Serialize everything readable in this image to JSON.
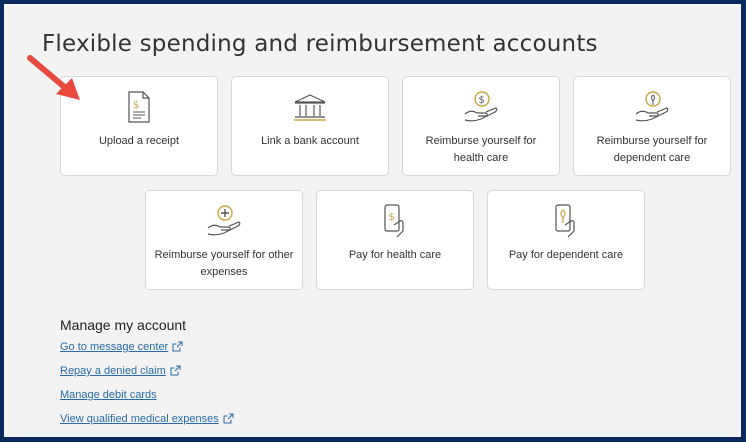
{
  "page": {
    "title": "Flexible spending and reimbursement accounts"
  },
  "cards": [
    {
      "label": "Upload a receipt",
      "icon": "receipt-icon"
    },
    {
      "label": "Link a bank account",
      "icon": "bank-icon"
    },
    {
      "label": "Reimburse yourself for health care",
      "icon": "hand-dollar-icon"
    },
    {
      "label": "Reimburse yourself for dependent care",
      "icon": "hand-tree-icon"
    },
    {
      "label": "Reimburse yourself for other expenses",
      "icon": "hand-plus-icon"
    },
    {
      "label": "Pay for health care",
      "icon": "phone-dollar-icon"
    },
    {
      "label": "Pay for dependent care",
      "icon": "phone-tree-icon"
    }
  ],
  "manage": {
    "title": "Manage my account",
    "links": [
      {
        "label": "Go to message center",
        "external": true
      },
      {
        "label": "Repay a denied claim",
        "external": true
      },
      {
        "label": "Manage debit cards",
        "external": false
      },
      {
        "label": "View qualified medical expenses",
        "external": true
      }
    ]
  },
  "colors": {
    "accent_gold": "#c9a640",
    "link": "#2a6aa8",
    "arrow": "#e84a3e",
    "frame": "#0b2a5c"
  }
}
